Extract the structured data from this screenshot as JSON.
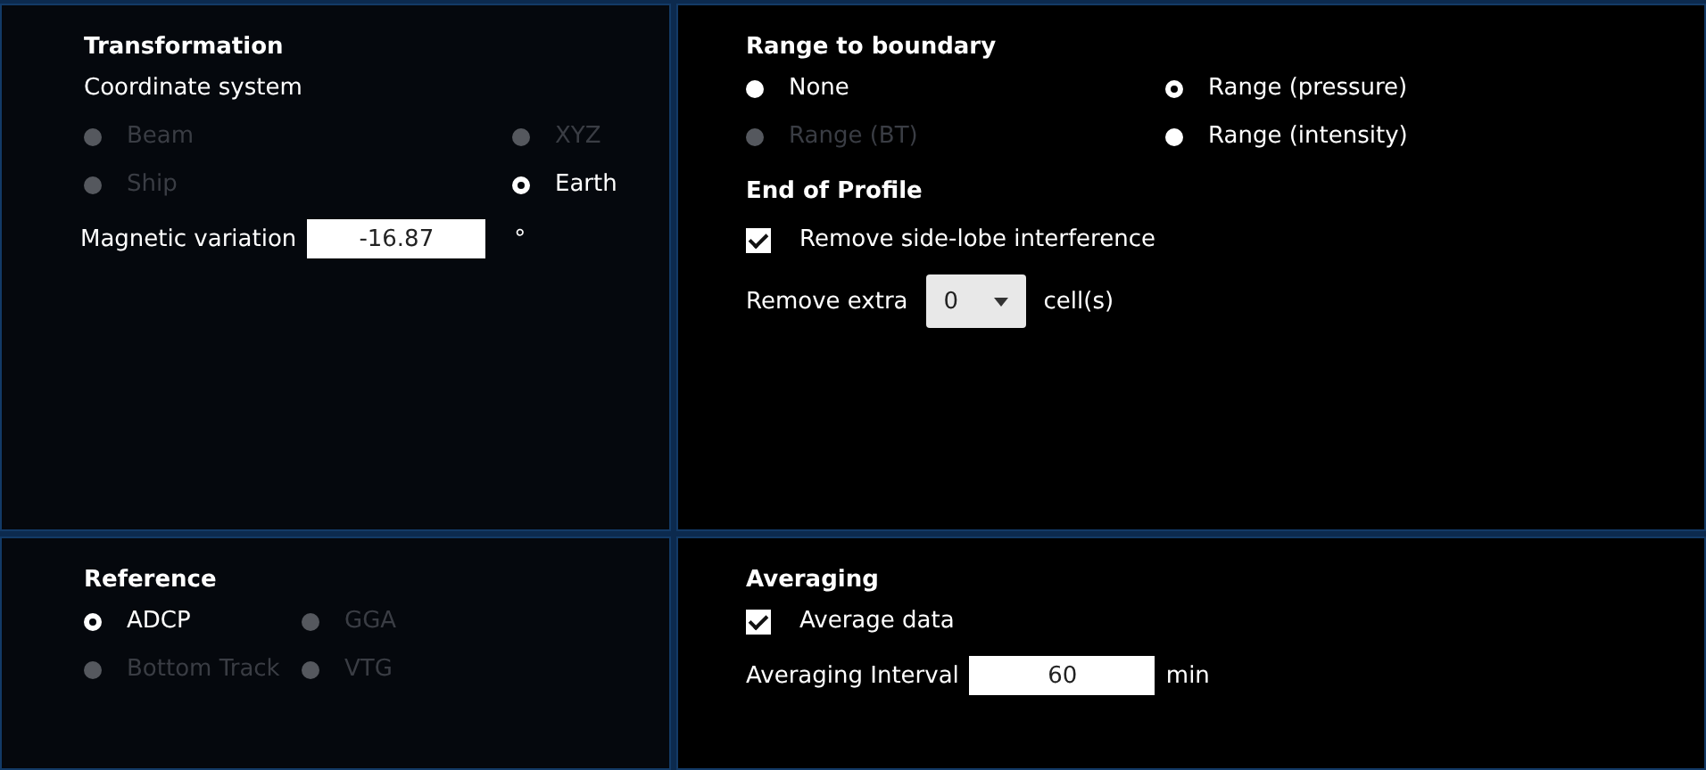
{
  "transformation": {
    "title": "Transformation",
    "subtitle": "Coordinate system",
    "options": [
      {
        "label": "Beam",
        "selected": false,
        "disabled": true
      },
      {
        "label": "XYZ",
        "selected": false,
        "disabled": true
      },
      {
        "label": "Ship",
        "selected": false,
        "disabled": true
      },
      {
        "label": "Earth",
        "selected": true,
        "disabled": false
      }
    ],
    "magnetic_variation": {
      "label": "Magnetic variation",
      "value": "-16.87",
      "unit": "°"
    }
  },
  "range_to_boundary": {
    "title": "Range to boundary",
    "options": [
      {
        "label": "None",
        "selected": false,
        "disabled": false
      },
      {
        "label": "Range (pressure)",
        "selected": true,
        "disabled": false
      },
      {
        "label": "Range (BT)",
        "selected": false,
        "disabled": true
      },
      {
        "label": "Range (intensity)",
        "selected": false,
        "disabled": false
      }
    ]
  },
  "end_of_profile": {
    "title": "End of Profile",
    "remove_side_lobe": {
      "label": "Remove side-lobe interference",
      "checked": true
    },
    "remove_extra": {
      "label": "Remove extra",
      "value": "0",
      "unit": "cell(s)"
    }
  },
  "reference": {
    "title": "Reference",
    "options": [
      {
        "label": "ADCP",
        "selected": true,
        "disabled": false
      },
      {
        "label": "GGA",
        "selected": false,
        "disabled": true
      },
      {
        "label": "Bottom Track",
        "selected": false,
        "disabled": true
      },
      {
        "label": "VTG",
        "selected": false,
        "disabled": true
      }
    ]
  },
  "averaging": {
    "title": "Averaging",
    "average_data": {
      "label": "Average data",
      "checked": true
    },
    "interval": {
      "label": "Averaging Interval",
      "value": "60",
      "unit": "min"
    }
  }
}
